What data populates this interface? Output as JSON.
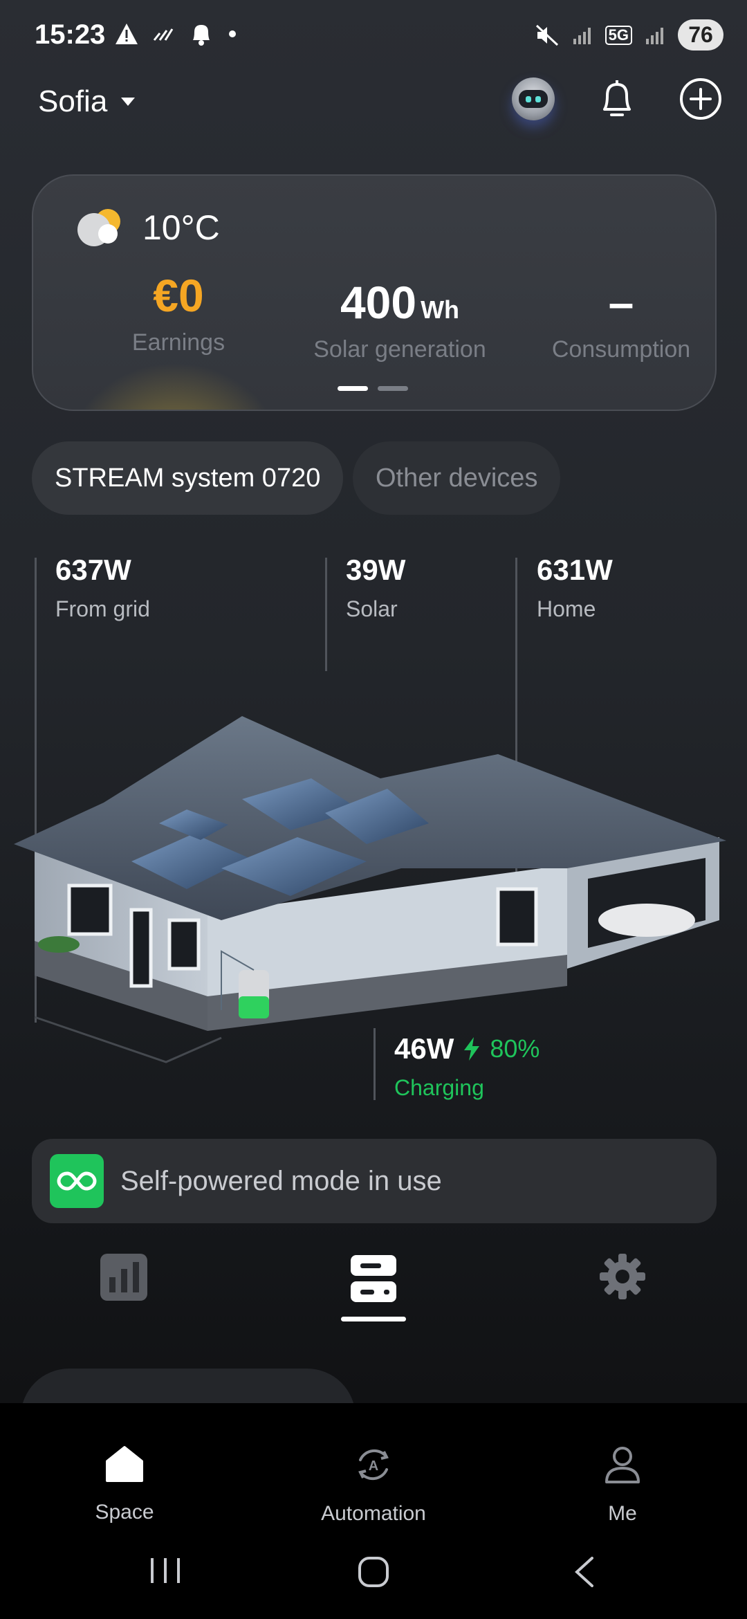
{
  "status_bar": {
    "time": "15:23",
    "network": "5G",
    "battery": "76"
  },
  "header": {
    "location": "Sofia",
    "icons": [
      "chevron-down-icon",
      "assistant-robot-icon",
      "bell-icon",
      "add-circle-icon"
    ]
  },
  "weather_card": {
    "temperature": "10°C",
    "weather_icon": "partly-cloudy-icon",
    "earnings_value": "€0",
    "earnings_label": "Earnings",
    "solar_value": "400",
    "solar_unit": "Wh",
    "solar_label": "Solar generation",
    "consumption_value": "–",
    "consumption_label": "Consumption",
    "page_indicator": {
      "pages": 2,
      "active": 1
    }
  },
  "device_tabs": [
    {
      "label": "STREAM system 0720",
      "active": true
    },
    {
      "label": "Other devices",
      "active": false
    }
  ],
  "energy_flow": {
    "grid": {
      "value": "637W",
      "label": "From grid"
    },
    "solar": {
      "value": "39W",
      "label": "Solar"
    },
    "home": {
      "value": "631W",
      "label": "Home"
    },
    "battery": {
      "value": "46W",
      "percent": "80%",
      "status": "Charging"
    }
  },
  "mode_banner": {
    "text": "Self-powered mode in use",
    "icon": "infinity-icon"
  },
  "section_tabs": [
    {
      "icon": "bar-chart-icon",
      "active": false
    },
    {
      "icon": "device-stack-icon",
      "active": true
    },
    {
      "icon": "settings-gear-icon",
      "active": false
    }
  ],
  "bottom_nav": [
    {
      "label": "Space",
      "icon": "home-icon",
      "active": true
    },
    {
      "label": "Automation",
      "icon": "automation-icon",
      "active": false
    },
    {
      "label": "Me",
      "icon": "person-icon",
      "active": false
    }
  ],
  "colors": {
    "accent_orange": "#f5a623",
    "accent_green": "#1fc45b",
    "card_bg": "#36393f",
    "muted_text": "#7a7e86"
  }
}
